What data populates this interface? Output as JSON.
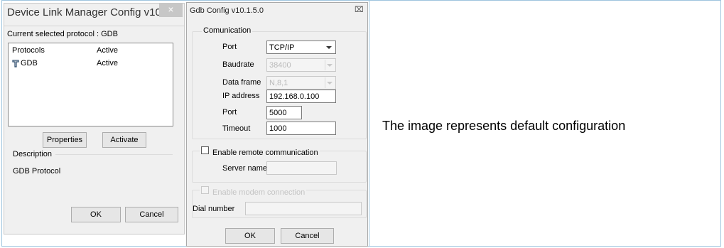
{
  "dlm": {
    "title": "Device Link Manager Config v10....",
    "current_label": "Current selected protocol : GDB",
    "columns": [
      "Protocols",
      "Active"
    ],
    "rows": [
      {
        "name": "GDB",
        "active": "Active"
      }
    ],
    "properties_btn": "Properties",
    "activate_btn": "Activate",
    "description_label": "Description",
    "description_value": "GDB Protocol",
    "ok_btn": "OK",
    "cancel_btn": "Cancel",
    "close_glyph": "×"
  },
  "gdb": {
    "title": "Gdb Config v10.1.5.0",
    "close_glyph": "⌧",
    "comm_group": "Comunication",
    "fields": {
      "port_label": "Port",
      "port_value": "TCP/IP",
      "baud_label": "Baudrate",
      "baud_value": "38400",
      "frame_label": "Data frame",
      "frame_value": "N,8,1",
      "ip_label": "IP address",
      "ip_value": "192.168.0.100",
      "port2_label": "Port",
      "port2_value": "5000",
      "timeout_label": "Timeout",
      "timeout_value": "1000"
    },
    "remote_label": "Enable remote communication",
    "server_label": "Server name",
    "server_value": "",
    "modem_label": "Enable modem connection",
    "dial_label": "Dial number",
    "dial_value": "",
    "ok_btn": "OK",
    "cancel_btn": "Cancel"
  },
  "caption": "The image represents default configuration"
}
